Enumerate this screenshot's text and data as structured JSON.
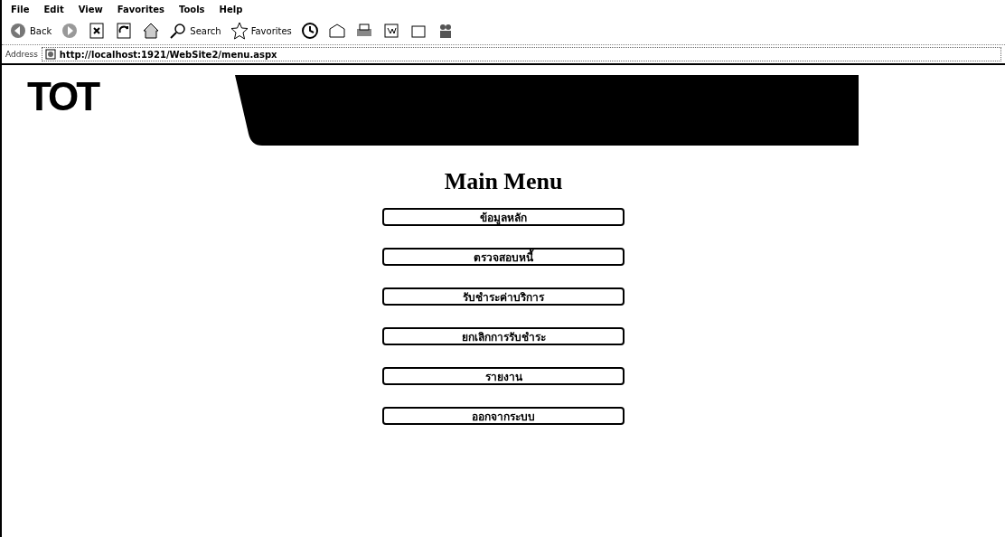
{
  "menu_bar": [
    "File",
    "Edit",
    "View",
    "Favorites",
    "Tools",
    "Help"
  ],
  "toolbar": [
    {
      "kind": "back",
      "label": "Back"
    },
    {
      "kind": "forward"
    },
    {
      "kind": "stop"
    },
    {
      "kind": "refresh"
    },
    {
      "kind": "home"
    },
    {
      "kind": "search",
      "label": "Search"
    },
    {
      "kind": "favorites",
      "label": "Favorites"
    },
    {
      "kind": "history"
    },
    {
      "kind": "mail"
    },
    {
      "kind": "print"
    },
    {
      "kind": "edit"
    },
    {
      "kind": "discuss"
    },
    {
      "kind": "messenger"
    }
  ],
  "address_bar": {
    "label": "Address",
    "url": "http://localhost:1921/WebSite2/menu.aspx"
  },
  "page": {
    "logo": "TOT",
    "heading": "Main Menu",
    "buttons": [
      {
        "label": "ข้อมูลหลัก"
      },
      {
        "label": "ตรวจสอบหนี้"
      },
      {
        "label": "รับชำระค่าบริการ"
      },
      {
        "label": "ยกเลิกการรับชำระ"
      },
      {
        "label": "รายงาน"
      },
      {
        "label": "ออกจากระบบ"
      }
    ]
  }
}
